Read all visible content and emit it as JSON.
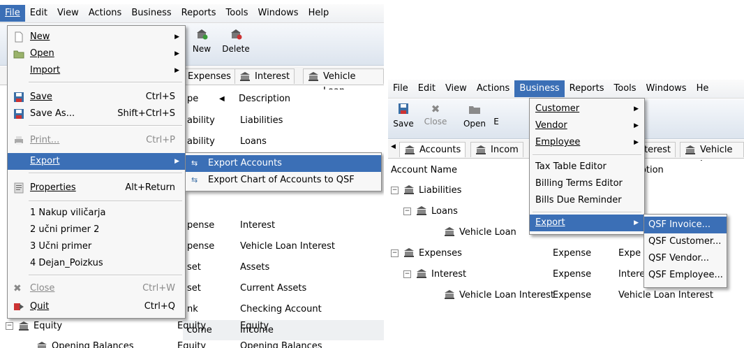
{
  "left": {
    "menubar": [
      "File",
      "Edit",
      "View",
      "Actions",
      "Business",
      "Reports",
      "Tools",
      "Windows",
      "Help"
    ],
    "toolbar": {
      "new": "New",
      "delete": "Delete"
    },
    "tabs": [
      "Expenses",
      "Interest",
      "Vehicle Loan"
    ],
    "columns": {
      "type_frag": "pe",
      "description": "Description"
    },
    "rows": [
      {
        "type": "ability",
        "desc": "Liabilities"
      },
      {
        "type": "ability",
        "desc": "Loans"
      },
      {
        "type": "",
        "desc": ""
      },
      {
        "type": "",
        "desc": ""
      },
      {
        "type": "",
        "desc": ""
      },
      {
        "type": "pense",
        "desc": "Interest"
      },
      {
        "type": "pense",
        "desc": "Vehicle Loan Interest"
      },
      {
        "type": "set",
        "desc": "Assets"
      },
      {
        "type": "set",
        "desc": "Current Assets"
      },
      {
        "type": "nk",
        "desc": "Checking Account"
      },
      {
        "type": "come",
        "desc": "Income"
      }
    ],
    "equity_row": {
      "name": "Equity",
      "type": "Equity",
      "desc": "Equity"
    },
    "opening_row": {
      "name": "Opening Balances",
      "type": "Equity",
      "desc": "Opening Balances"
    },
    "file_menu": {
      "new": "New",
      "open": "Open",
      "import": "Import",
      "save": "Save",
      "save_acc": "Ctrl+S",
      "save_as": "Save As...",
      "save_as_acc": "Shift+Ctrl+S",
      "print": "Print...",
      "print_acc": "Ctrl+P",
      "export": "Export",
      "properties": "Properties",
      "properties_acc": "Alt+Return",
      "recent1": "1 Nakup viličarja",
      "recent2": "2 učni primer 2",
      "recent3": "3 Učni primer",
      "recent4": "4 Dejan_Poizkus",
      "close": "Close",
      "close_acc": "Ctrl+W",
      "quit": "Quit",
      "quit_acc": "Ctrl+Q"
    },
    "export_submenu": [
      "Export Accounts",
      "Export Chart of Accounts to QSF"
    ]
  },
  "right": {
    "menubar": [
      "File",
      "Edit",
      "View",
      "Actions",
      "Business",
      "Reports",
      "Tools",
      "Windows",
      "He"
    ],
    "toolbar": {
      "save": "Save",
      "close": "Close",
      "open": "Open",
      "e_frag": "E"
    },
    "tabs": [
      "Accounts",
      "Incom",
      "terest",
      "Vehicle L"
    ],
    "columns": {
      "account_name": "Account Name",
      "desc_frag": "iption"
    },
    "rows": [
      {
        "name": "Liabilities",
        "type": "",
        "desc": "ities"
      },
      {
        "name": "Loans",
        "type": "",
        "desc": ""
      },
      {
        "name": "Vehicle Loan",
        "type": "",
        "desc": ""
      },
      {
        "name": "Expenses",
        "type": "Expense",
        "desc": "Expe"
      },
      {
        "name": "Interest",
        "type": "Expense",
        "desc": "Intere"
      },
      {
        "name": "Vehicle Loan Interest",
        "type": "Expense",
        "desc": "Vehicle Loan Interest"
      }
    ],
    "business_menu": {
      "customer": "Customer",
      "vendor": "Vendor",
      "employee": "Employee",
      "tax": "Tax Table Editor",
      "billing": "Billing Terms Editor",
      "bills_due": "Bills Due Reminder",
      "export": "Export"
    },
    "export_submenu": [
      "QSF Invoice...",
      "QSF Customer...",
      "QSF Vendor...",
      "QSF Employee..."
    ]
  },
  "colors": {
    "highlight": "#3b6fb6",
    "menu_bg": "#f7f7f7"
  }
}
